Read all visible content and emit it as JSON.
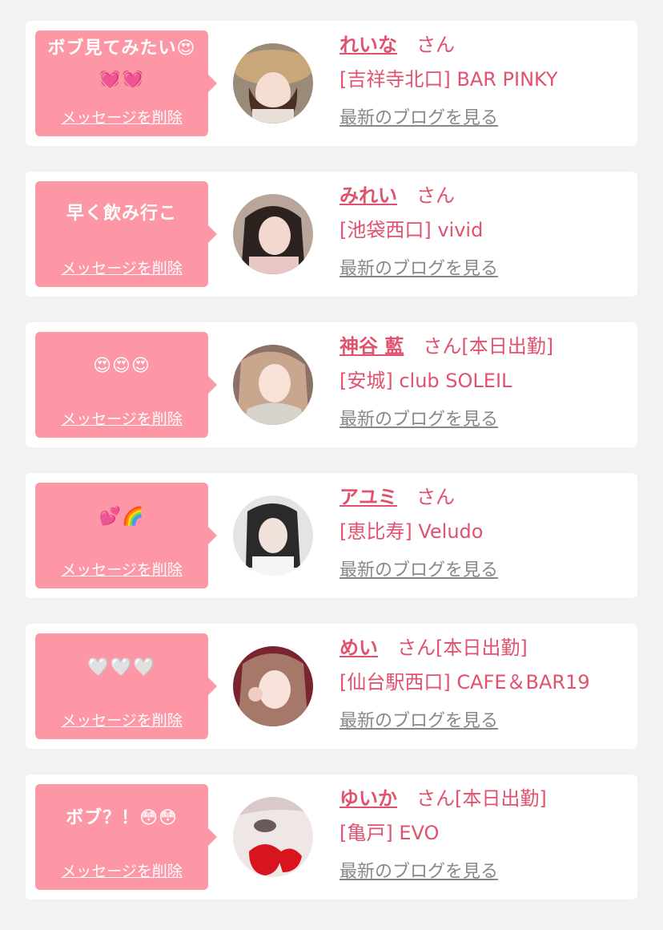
{
  "accent_color": "#e0526e",
  "bubble_color": "#fd97a6",
  "blog_link_label": "最新のブログを見る",
  "delete_label": "メッセージを削除",
  "cards": [
    {
      "message_lines": [
        "ボブ見てみたい😍",
        "💓💓"
      ],
      "name": "れいな",
      "suffix": "さん",
      "status": "",
      "shop": "[吉祥寺北口] BAR PINKY"
    },
    {
      "message_lines": [
        "早く飲み行こ"
      ],
      "name": "みれい",
      "suffix": "さん",
      "status": "",
      "shop": "[池袋西口] vivid"
    },
    {
      "message_lines": [
        "😍😍😍"
      ],
      "name": "神谷 藍",
      "suffix": "さん",
      "status": "[本日出勤]",
      "shop": "[安城] club SOLEIL"
    },
    {
      "message_lines": [
        "💕🌈"
      ],
      "name": "アユミ",
      "suffix": "さん",
      "status": "",
      "shop": "[恵比寿] Veludo"
    },
    {
      "message_lines": [
        "🤍🤍🤍"
      ],
      "name": "めい",
      "suffix": "さん",
      "status": "[本日出勤]",
      "shop": "[仙台駅西口] CAFE＆BAR19"
    },
    {
      "message_lines": [
        "ボブ？！😳😳"
      ],
      "name": "ゆいか",
      "suffix": "さん",
      "status": "[本日出勤]",
      "shop": "[亀戸] EVO"
    }
  ]
}
